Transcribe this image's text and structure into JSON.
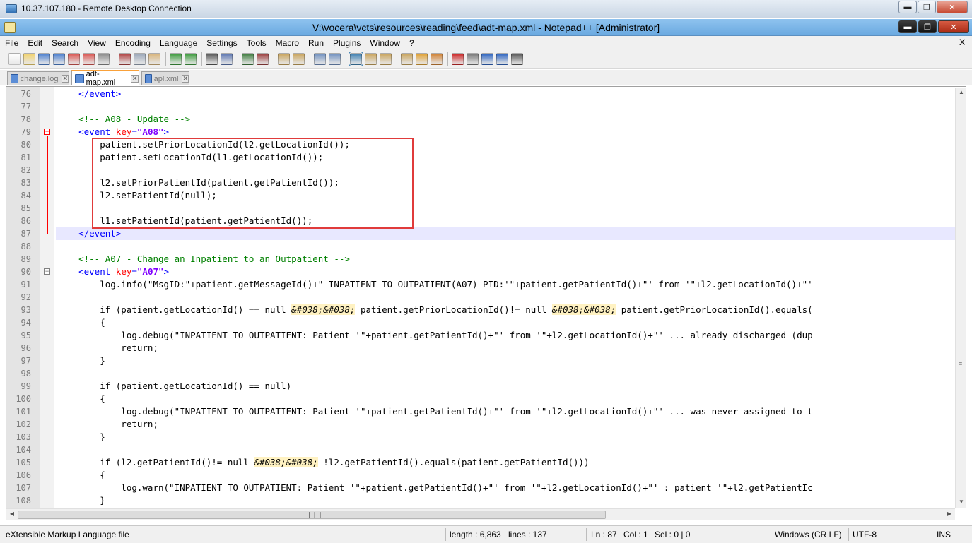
{
  "rdc_title": "10.37.107.180 - Remote Desktop Connection",
  "window_title": "V:\\vocera\\vcts\\resources\\reading\\feed\\adt-map.xml - Notepad++ [Administrator]",
  "menu": [
    "File",
    "Edit",
    "Search",
    "View",
    "Encoding",
    "Language",
    "Settings",
    "Tools",
    "Macro",
    "Run",
    "Plugins",
    "Window",
    "?"
  ],
  "menu_close": "X",
  "toolbar_icons": [
    "new-file-icon",
    "open-file-icon",
    "save-icon",
    "save-all-icon",
    "close-icon",
    "close-all-icon",
    "print-icon",
    "cut-icon",
    "copy-icon",
    "paste-icon",
    "undo-icon",
    "redo-icon",
    "find-icon",
    "replace-icon",
    "zoom-in-icon",
    "zoom-out-icon",
    "sync-vertical-icon",
    "sync-horizontal-icon",
    "word-wrap-icon",
    "show-all-chars-icon",
    "indent-guide-icon",
    "user-lang-icon",
    "doc-map-icon",
    "function-list-icon",
    "folder-workspace-icon",
    "monitor-icon",
    "record-macro-icon",
    "stop-record-icon",
    "play-macro-icon",
    "run-macro-multiple-icon",
    "save-macro-icon"
  ],
  "tabs": [
    {
      "label": "change.log",
      "active": false
    },
    {
      "label": "adt-map.xml",
      "active": true
    },
    {
      "label": "apl.xml",
      "active": false
    }
  ],
  "lines": [
    {
      "n": "76",
      "text": "    </event>"
    },
    {
      "n": "77",
      "text": ""
    },
    {
      "n": "78",
      "text": "    <!-- A08 - Update -->"
    },
    {
      "n": "79",
      "text": "    <event key=\"A08\">"
    },
    {
      "n": "80",
      "text": "        patient.setPriorLocationId(l2.getLocationId());"
    },
    {
      "n": "81",
      "text": "        patient.setLocationId(l1.getLocationId());"
    },
    {
      "n": "82",
      "text": ""
    },
    {
      "n": "83",
      "text": "        l2.setPriorPatientId(patient.getPatientId());"
    },
    {
      "n": "84",
      "text": "        l2.setPatientId(null);"
    },
    {
      "n": "85",
      "text": ""
    },
    {
      "n": "86",
      "text": "        l1.setPatientId(patient.getPatientId());"
    },
    {
      "n": "87",
      "text": "    </event>"
    },
    {
      "n": "88",
      "text": ""
    },
    {
      "n": "89",
      "text": "    <!-- A07 - Change an Inpatient to an Outpatient -->"
    },
    {
      "n": "90",
      "text": "    <event key=\"A07\">"
    },
    {
      "n": "91",
      "text": "        log.info(\"MsgID:\"+patient.getMessageId()+\" INPATIENT TO OUTPATIENT(A07) PID:'\"+patient.getPatientId()+\"' from '\"+l2.getLocationId()+\"'"
    },
    {
      "n": "92",
      "text": ""
    },
    {
      "n": "93",
      "text": "        if (patient.getLocationId() == null &#038;&#038; patient.getPriorLocationId()!= null &#038;&#038; patient.getPriorLocationId().equals("
    },
    {
      "n": "94",
      "text": "        {"
    },
    {
      "n": "95",
      "text": "            log.debug(\"INPATIENT TO OUTPATIENT: Patient '\"+patient.getPatientId()+\"' from '\"+l2.getLocationId()+\"' ... already discharged (dup"
    },
    {
      "n": "96",
      "text": "            return;"
    },
    {
      "n": "97",
      "text": "        }"
    },
    {
      "n": "98",
      "text": ""
    },
    {
      "n": "99",
      "text": "        if (patient.getLocationId() == null)"
    },
    {
      "n": "100",
      "text": "        {"
    },
    {
      "n": "101",
      "text": "            log.debug(\"INPATIENT TO OUTPATIENT: Patient '\"+patient.getPatientId()+\"' from '\"+l2.getLocationId()+\"' ... was never assigned to t"
    },
    {
      "n": "102",
      "text": "            return;"
    },
    {
      "n": "103",
      "text": "        }"
    },
    {
      "n": "104",
      "text": ""
    },
    {
      "n": "105",
      "text": "        if (l2.getPatientId()!= null &#038;&#038; !l2.getPatientId().equals(patient.getPatientId()))"
    },
    {
      "n": "106",
      "text": "        {"
    },
    {
      "n": "107",
      "text": "            log.warn(\"INPATIENT TO OUTPATIENT: Patient '\"+patient.getPatientId()+\"' from '\"+l2.getLocationId()+\"' : patient '\"+l2.getPatientIc"
    },
    {
      "n": "108",
      "text": "        }"
    }
  ],
  "current_line": "87",
  "status": {
    "file_type": "eXtensible Markup Language file",
    "length": "length : 6,863",
    "lines": "lines : 137",
    "ln": "Ln : 87",
    "col": "Col : 1",
    "sel": "Sel : 0 | 0",
    "eol": "Windows (CR LF)",
    "encoding": "UTF-8",
    "mode": "INS"
  },
  "colors": {
    "tag": "#0000ff",
    "attribute": "#ff0000",
    "attr_value": "#8000ff",
    "comment": "#008000",
    "highlight_box": "#e03b3b",
    "current_line_bg": "#e8e8ff"
  }
}
